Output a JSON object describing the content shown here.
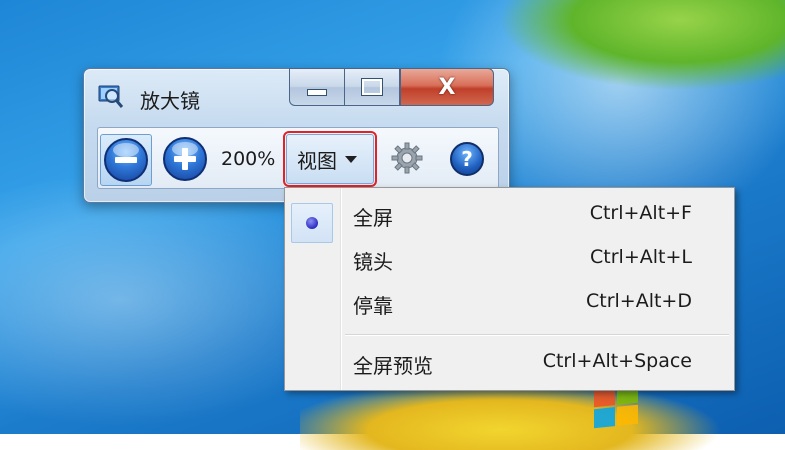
{
  "window": {
    "title": "放大镜",
    "close_glyph": "X"
  },
  "toolbar": {
    "zoom_out_icon": "minus-icon",
    "zoom_in_icon": "plus-icon",
    "zoom_level": "200%",
    "view_label": "视图",
    "settings_icon": "gear-icon",
    "help_glyph": "?"
  },
  "view_menu": {
    "items": [
      {
        "label": "全屏",
        "shortcut": "Ctrl+Alt+F",
        "selected": true
      },
      {
        "label": "镜头",
        "shortcut": "Ctrl+Alt+L",
        "selected": false
      },
      {
        "label": "停靠",
        "shortcut": "Ctrl+Alt+D",
        "selected": false
      },
      {
        "label": "全屏预览",
        "shortcut": "Ctrl+Alt+Space",
        "selected": false
      }
    ]
  },
  "colors": {
    "highlight_outline": "#e0222a",
    "radio_dot": "#2a2dbf",
    "close_button": "#c0402a"
  }
}
